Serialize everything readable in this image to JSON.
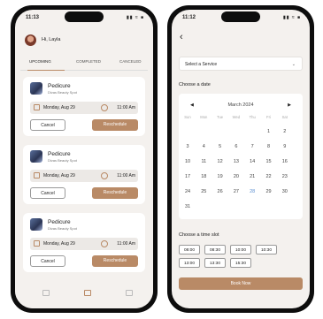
{
  "left": {
    "status": {
      "time": "11:13",
      "icons": "▮▮ ≈ ■"
    },
    "greeting": "Hi, Layla",
    "tabs": {
      "upcoming": "UPCOMING",
      "completed": "COMPLETED",
      "canceled": "CANCELED"
    },
    "appointments": [
      {
        "service": "Pedicure",
        "shop": "Divas Beauty Spot",
        "date": "Monday, Aug 29",
        "time": "11:00 Am",
        "cancel": "Cancel",
        "reschedule": "Reschedule"
      },
      {
        "service": "Pedicure",
        "shop": "Divas Beauty Spot",
        "date": "Monday, Aug 29",
        "time": "11:00 Am",
        "cancel": "Cancel",
        "reschedule": "Reschedule"
      },
      {
        "service": "Pedicure",
        "shop": "Divas Beauty Spot",
        "date": "Monday, Aug 29",
        "time": "11:00 Am",
        "cancel": "Cancel",
        "reschedule": "Reschedule"
      }
    ],
    "nav_icons": [
      "home-icon",
      "calendar-icon",
      "wallet-icon"
    ]
  },
  "right": {
    "status": {
      "time": "11:12",
      "icons": "▮▮ ≈ ■"
    },
    "back": "‹",
    "select_service": "Select a Service",
    "choose_date": "Choose a date",
    "calendar": {
      "month": "March 2024",
      "prev": "◀",
      "next": "▶",
      "weekdays": [
        "Sun",
        "Mon",
        "Tue",
        "Wed",
        "Thu",
        "Fri",
        "Sat"
      ],
      "weeks": [
        [
          "",
          "",
          "",
          "",
          "",
          "1",
          "2"
        ],
        [
          "3",
          "4",
          "5",
          "6",
          "7",
          "8",
          "9"
        ],
        [
          "10",
          "11",
          "12",
          "13",
          "14",
          "15",
          "16"
        ],
        [
          "17",
          "18",
          "19",
          "20",
          "21",
          "22",
          "23"
        ],
        [
          "24",
          "25",
          "26",
          "27",
          "28",
          "29",
          "30"
        ],
        [
          "31",
          "",
          "",
          "",
          "",
          "",
          ""
        ]
      ],
      "highlighted_day": "28"
    },
    "choose_time": "Choose a time slot",
    "slots": [
      "08:00",
      "08:30",
      "10:00",
      "10:30",
      "13:00",
      "13:30",
      "15:30"
    ],
    "book_now": "Book Now"
  },
  "colors": {
    "accent": "#b98a66",
    "background": "#f4f1ee",
    "highlight": "#5b8fd0"
  }
}
